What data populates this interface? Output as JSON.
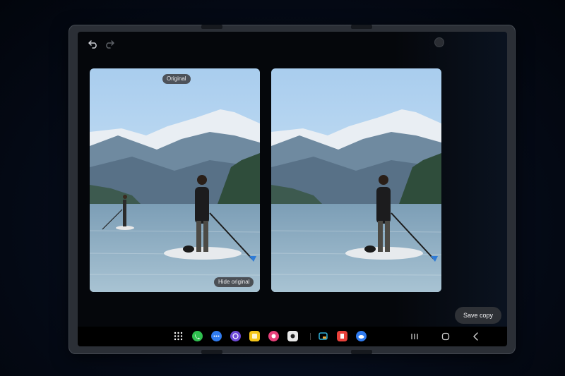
{
  "editor": {
    "undo_icon": "undo-icon",
    "redo_icon": "redo-icon",
    "original_label": "Original",
    "hide_original_label": "Hide original",
    "save_copy_label": "Save copy"
  },
  "taskbar": {
    "apps": [
      {
        "name": "apps-grid-icon",
        "color": "#ffffff"
      },
      {
        "name": "phone-app-icon",
        "color": "#2fbf4f"
      },
      {
        "name": "messages-app-icon",
        "color": "#2f7bf0"
      },
      {
        "name": "internet-app-icon",
        "color": "#6f4bd8"
      },
      {
        "name": "notes-app-icon",
        "color": "#f5c518"
      },
      {
        "name": "gallery-app-icon",
        "color": "#e8407a"
      },
      {
        "name": "camera-app-icon",
        "color": "#e8e8e8"
      },
      {
        "name": "recent-app-1-icon",
        "color": "#2fb0d8"
      },
      {
        "name": "recent-app-2-icon",
        "color": "#e8403a"
      },
      {
        "name": "recent-app-3-icon",
        "color": "#2f7bf0"
      }
    ],
    "nav": [
      "recents-nav-icon",
      "home-nav-icon",
      "back-nav-icon"
    ]
  }
}
